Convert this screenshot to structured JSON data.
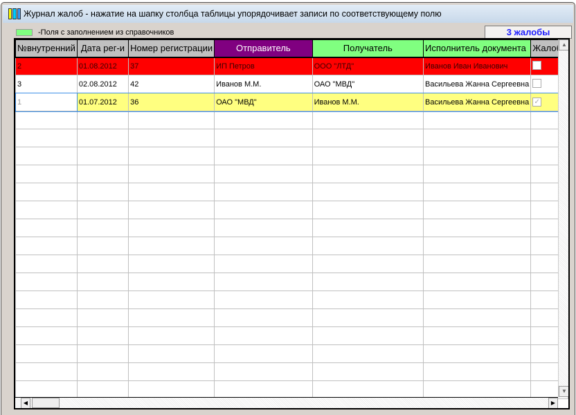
{
  "window": {
    "title": "Журнал жалоб - нажатие на шапку столбца таблицы упорядочивает записи по соответствующему полю"
  },
  "legend": {
    "text": "-Поля с заполнением из справочников",
    "color": "#80ff80"
  },
  "count_label": "3 жалобы",
  "columns": [
    {
      "label": "№внутренний",
      "bg": "#c0c0c0",
      "fg": "#000"
    },
    {
      "label": "Дата рег-и",
      "bg": "#c0c0c0",
      "fg": "#000"
    },
    {
      "label": "Номер регистрации",
      "bg": "#c0c0c0",
      "fg": "#000"
    },
    {
      "label": "Отправитель",
      "bg": "#800080",
      "fg": "#fff"
    },
    {
      "label": "Получатель",
      "bg": "#80ff80",
      "fg": "#000"
    },
    {
      "label": "Исполнитель документа",
      "bg": "#80ff80",
      "fg": "#000"
    },
    {
      "label": "Жалоба",
      "bg": "#c0c0c0",
      "fg": "#000"
    }
  ],
  "rows": [
    {
      "id": "2",
      "date": "01.08.2012",
      "num": "37",
      "sender": "ИП Петров",
      "recipient": "ООО \"ЛТД\"",
      "executor": "Иванов Иван Иванович",
      "checked": false,
      "style": "red"
    },
    {
      "id": "3",
      "date": "02.08.2012",
      "num": "42",
      "sender": "Иванов М.М.",
      "recipient": "ОАО \"МВД\"",
      "executor": "Васильева Жанна Сергеевна",
      "checked": false,
      "style": "white"
    },
    {
      "id": "1",
      "date": "01.07.2012",
      "num": "36",
      "sender": "ОАО \"МВД\"",
      "recipient": "Иванов М.М.",
      "executor": "Васильева Жанна Сергеевна",
      "checked": true,
      "style": "yellow"
    }
  ]
}
